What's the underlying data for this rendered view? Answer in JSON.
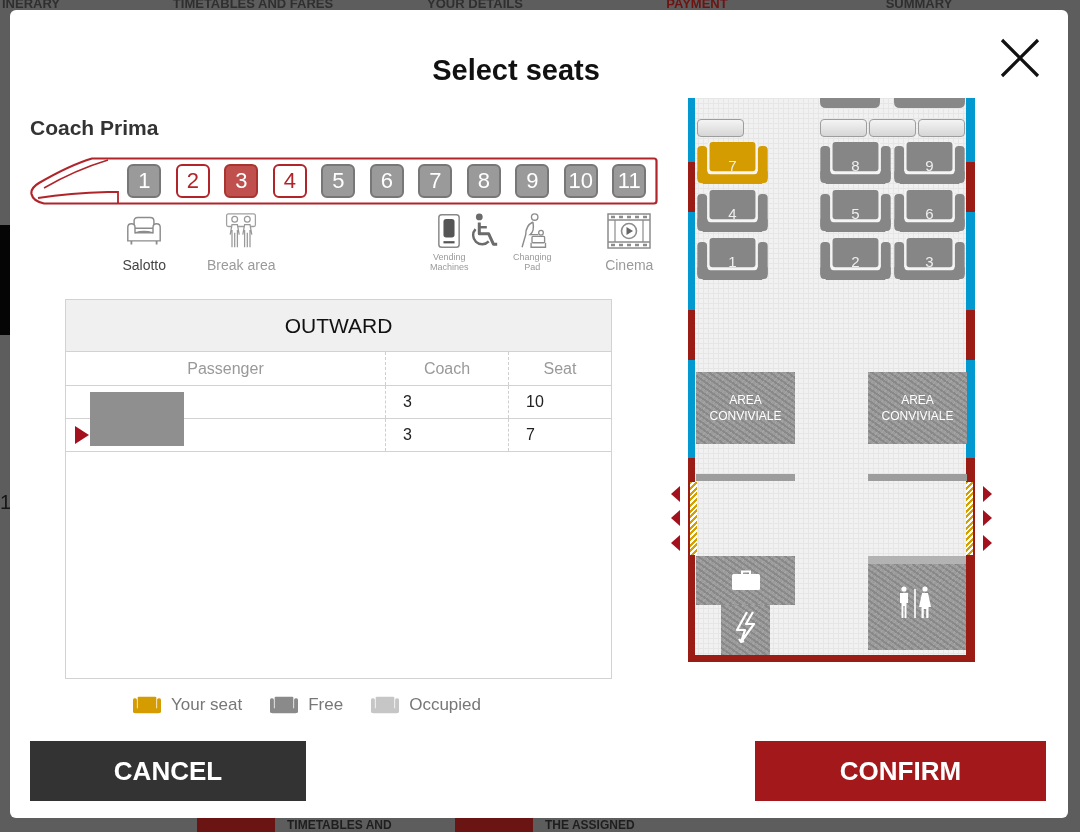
{
  "background": {
    "steps": [
      {
        "label": "INERARY",
        "current": false
      },
      {
        "label": "TIMETABLES AND FARES",
        "current": false
      },
      {
        "label": "YOUR DETAILS",
        "current": false
      },
      {
        "label": "PAYMENT",
        "current": true
      },
      {
        "label": "SUMMARY",
        "current": false
      }
    ],
    "edge_fragment": "1",
    "footer_items": [
      "TIMETABLES AND",
      "THE ASSIGNED"
    ]
  },
  "dialog": {
    "title": "Select seats",
    "coach_class_title": "Coach Prima",
    "coaches": [
      {
        "label": "1",
        "available": false,
        "selected": false,
        "amenities": [
          {
            "kind": "armchair",
            "label": "Salotto",
            "highlighted": true
          }
        ]
      },
      {
        "label": "2",
        "available": true,
        "selected": false
      },
      {
        "label": "3",
        "available": true,
        "selected": true,
        "amenities": [
          {
            "kind": "people",
            "label": "Break area",
            "highlighted": false
          }
        ]
      },
      {
        "label": "4",
        "available": true,
        "selected": false
      },
      {
        "label": "5",
        "available": false,
        "selected": false
      },
      {
        "label": "6",
        "available": false,
        "selected": false
      },
      {
        "label": "7",
        "available": false,
        "selected": false,
        "amenities": [
          {
            "kind": "vending",
            "label": "Vending Machines",
            "highlighted": false
          }
        ]
      },
      {
        "label": "8",
        "available": false,
        "selected": false,
        "amenities": [
          {
            "kind": "wheelchair"
          }
        ]
      },
      {
        "label": "9",
        "available": false,
        "selected": false,
        "amenities": [
          {
            "kind": "changing",
            "label": "Changing Pad",
            "highlighted": false
          }
        ]
      },
      {
        "label": "10",
        "available": false,
        "selected": false
      },
      {
        "label": "11",
        "available": false,
        "selected": false,
        "amenities": [
          {
            "kind": "cinema",
            "label": "Cinema",
            "highlighted": false
          }
        ]
      }
    ],
    "outward_table": {
      "title": "OUTWARD",
      "columns": [
        "Passenger",
        "Coach",
        "Seat"
      ],
      "rows": [
        {
          "coach": "3",
          "seat": "10",
          "selected": false
        },
        {
          "coach": "3",
          "seat": "7",
          "selected": true
        }
      ]
    },
    "legend": [
      {
        "label": "Your seat",
        "color": "#d49c00"
      },
      {
        "label": "Free",
        "color": "#8a8a8a"
      },
      {
        "label": "Occupied",
        "color": "#c6c6c6"
      }
    ],
    "seat_map": {
      "seat_rows": [
        {
          "left": [
            {
              "label": "7",
              "selected": true
            }
          ],
          "right": [
            {
              "label": "8",
              "selected": false
            },
            {
              "label": "9",
              "selected": false
            }
          ]
        },
        {
          "left": [
            {
              "label": "4",
              "selected": false
            }
          ],
          "right": [
            {
              "label": "5",
              "selected": false
            },
            {
              "label": "6",
              "selected": false
            }
          ]
        },
        {
          "left": [
            {
              "label": "1",
              "selected": false
            }
          ],
          "right": [
            {
              "label": "2",
              "selected": false
            },
            {
              "label": "3",
              "selected": false
            }
          ]
        }
      ],
      "areas": [
        {
          "label": "AREA CONVIVIALE"
        },
        {
          "label": "AREA CONVIVIALE"
        }
      ]
    },
    "buttons": [
      {
        "label": "CANCEL",
        "kind": "secondary"
      },
      {
        "label": "CONFIRM",
        "kind": "primary"
      }
    ]
  }
}
